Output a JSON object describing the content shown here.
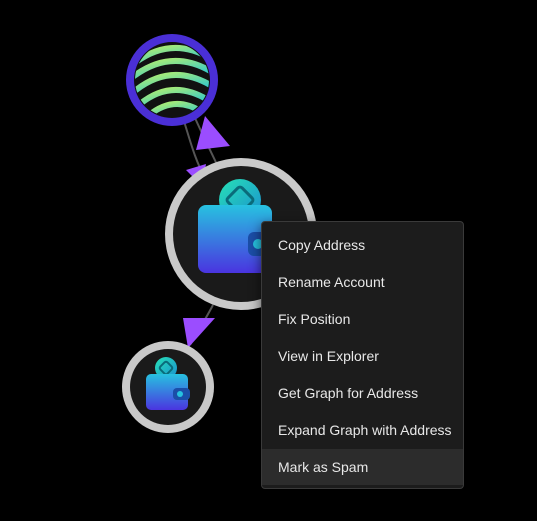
{
  "graph": {
    "nodes": [
      {
        "id": "token-node",
        "icon": "striped-token-logo-icon"
      },
      {
        "id": "wallet-node-selected",
        "icon": "wallet-icon"
      },
      {
        "id": "wallet-node-child",
        "icon": "wallet-icon"
      }
    ],
    "edges": [
      {
        "from": "token-node",
        "to": "wallet-node-selected"
      },
      {
        "from": "wallet-node-selected",
        "to": "wallet-node-child"
      }
    ],
    "colors": {
      "arrow": "#9b4dff",
      "node_ring": "#c9c9c9",
      "token_ring": "#4a2fd6",
      "wallet_body": "#2f7de8",
      "coin": "#1fcfa8"
    }
  },
  "context_menu": {
    "items": [
      {
        "label": "Copy Address"
      },
      {
        "label": "Rename Account"
      },
      {
        "label": "Fix Position"
      },
      {
        "label": "View in Explorer"
      },
      {
        "label": "Get Graph for Address"
      },
      {
        "label": "Expand Graph with Address"
      },
      {
        "label": "Mark as Spam",
        "highlighted": true
      }
    ]
  }
}
